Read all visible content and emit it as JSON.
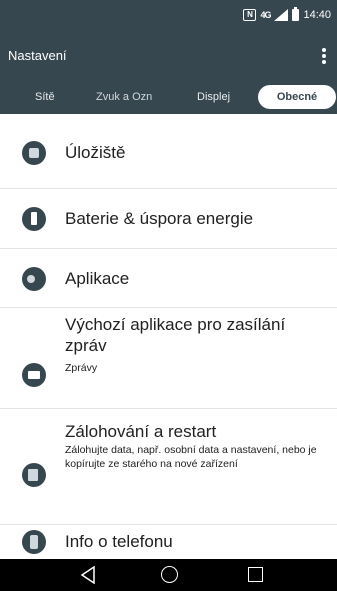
{
  "status_bar": {
    "nfc_icon": "N",
    "data_icon": "4G",
    "time": "14:40"
  },
  "app_bar": {
    "title": "Nastavení",
    "overflow_icon": "more-vert-icon"
  },
  "tabs": [
    {
      "label": "Sítě",
      "selected": false
    },
    {
      "label": "Zvuk a Oznámení",
      "selected": false
    },
    {
      "label": "Displej",
      "selected": false
    },
    {
      "label": "Obecné",
      "selected": true
    }
  ],
  "items": [
    {
      "icon": "storage-icon",
      "title": "Úložiště"
    },
    {
      "icon": "battery-icon",
      "title": "Baterie & úspora energie"
    },
    {
      "icon": "apps-icon",
      "title": "Aplikace"
    },
    {
      "icon": "message-icon",
      "title": "Výchozí aplikace pro zasílání zpráv",
      "subtitle": "Zprávy"
    },
    {
      "icon": "backup-icon",
      "title": "Zálohování a restart",
      "subtitle": "Zálohujte data, např. osobní data a nastavení, nebo je kopírujte ze starého na nové zařízení"
    },
    {
      "icon": "phone-info-icon",
      "title": "Info o telefonu"
    }
  ],
  "nav_bar": {
    "back_icon": "back-icon",
    "home_icon": "home-icon",
    "recents_icon": "recents-icon"
  },
  "colors": {
    "header": "#37474f",
    "icon": "#37474f",
    "nav_bar": "#000000",
    "background": "#ffffff"
  }
}
